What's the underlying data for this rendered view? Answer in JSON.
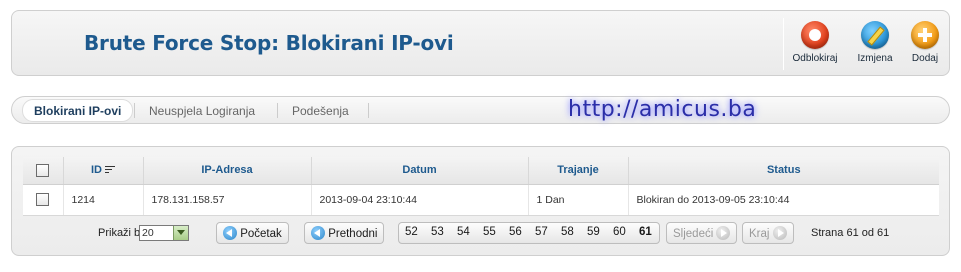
{
  "header": {
    "title": "Brute Force Stop: Blokirani IP-ovi",
    "toolbar": [
      {
        "label": "Odblokiraj",
        "icon": "unblock-icon"
      },
      {
        "label": "Izmjena",
        "icon": "edit-icon"
      },
      {
        "label": "Dodaj",
        "icon": "add-icon"
      }
    ]
  },
  "tabs": [
    {
      "label": "Blokirani IP-ovi",
      "active": true
    },
    {
      "label": "Neuspjela Logiranja",
      "active": false
    },
    {
      "label": "Podešenja",
      "active": false
    }
  ],
  "watermark": "http://amicus.ba",
  "table": {
    "columns": [
      "ID",
      "IP-Adresa",
      "Datum",
      "Trajanje",
      "Status"
    ],
    "sorted_column": "ID",
    "rows": [
      {
        "id": "1214",
        "ip": "178.131.158.57",
        "date": "2013-09-04 23:10:44",
        "duration": "1 Dan",
        "status": "Blokiran do 2013-09-05 23:10:44"
      }
    ]
  },
  "pagination": {
    "limit_label": "Prikaži broj",
    "limit_value": "20",
    "start_label": "Početak",
    "prev_label": "Prethodni",
    "pages": [
      "52",
      "53",
      "54",
      "55",
      "56",
      "57",
      "58",
      "59",
      "60",
      "61"
    ],
    "current_page": "61",
    "next_label": "Sljedeći",
    "end_label": "Kraj",
    "page_info": "Strana 61 od 61"
  },
  "colors": {
    "title": "#1e5a8e",
    "watermark": "#2b2ea8",
    "unblock": "#e1401c",
    "edit": "#2a94d6",
    "add": "#f39a12"
  }
}
